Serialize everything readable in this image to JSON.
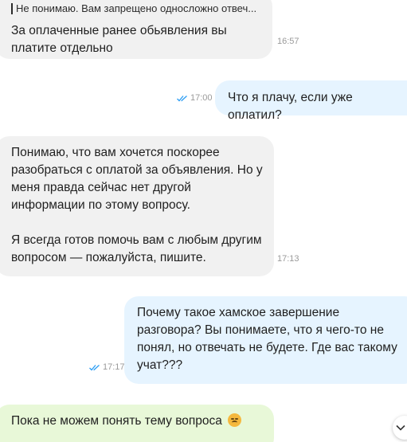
{
  "messages": [
    {
      "quote": "Не понимаю. Вам запрещено односложно отвеч...",
      "lines": [
        "За оплаченные ранее обьявления вы",
        "платите отдельно"
      ],
      "time": "16:57"
    },
    {
      "text": "Что я плачу, если уже оплатил?",
      "time": "17:00",
      "status": "read"
    },
    {
      "paragraph1": [
        "Понимаю, что вам хочется поскорее",
        "разобраться с оплатой за объявления. Но у",
        "меня правда сейчас нет другой",
        "информации по этому вопросу."
      ],
      "paragraph2": [
        "Я всегда готов помочь вам с любым другим",
        "вопросом — пожалуйста, пишите."
      ],
      "time": "17:13"
    },
    {
      "lines": [
        "Почему такое хамское завершение",
        "разговора? Вы понимаете, что я чего-то не",
        "понял, но отвечать не будете. Где вас такому",
        "учат???"
      ],
      "time": "17:17",
      "status": "read"
    },
    {
      "text": "Пока не можем понять тему вопроса",
      "emoji": "sad-face"
    }
  ],
  "colors": {
    "incoming_bg": "#f1f1f1",
    "outgoing_bg": "#e6f4ff",
    "bot_bg": "#e8f8d8",
    "read_tick": "#2a9df4"
  }
}
